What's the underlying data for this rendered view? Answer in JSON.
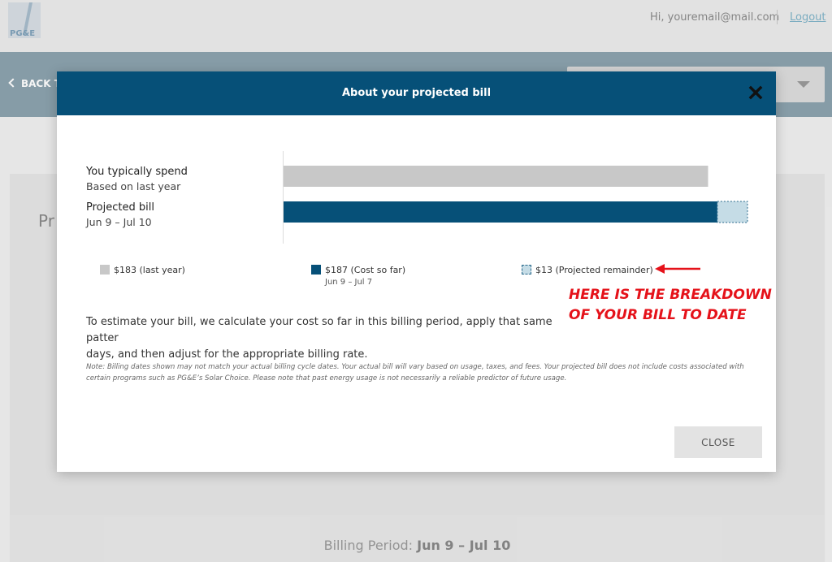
{
  "header": {
    "logo_text": "PG&E",
    "greeting": "Hi, youremail@mail.com",
    "logout_label": "Logout"
  },
  "nav": {
    "back_label": "BACK T"
  },
  "background": {
    "card_title_fragment": "Pr",
    "billing_period_label": "Billing Period:",
    "billing_period_value": "Jun 9 – Jul 10"
  },
  "modal": {
    "title": "About your projected bill",
    "rows": [
      {
        "label": "You typically spend",
        "sub": "Based on last year"
      },
      {
        "label": "Projected bill",
        "sub": "Jun 9 – Jul 10"
      }
    ],
    "legend": [
      {
        "text": "$183 (last year)",
        "color": "#c8c8c8"
      },
      {
        "text": "$187 (Cost so far)",
        "dates": "Jun 9 – Jul 7",
        "color": "#065078"
      },
      {
        "text": "$13 (Projected remainder)",
        "color": "#c5dce6"
      }
    ],
    "explanation": "To estimate your bill, we calculate your cost so far in this billing period, apply that same patter",
    "explanation_line2": "days, and then adjust for the appropriate billing rate.",
    "note": "Note: Billing dates shown may not match your actual billing cycle dates. Your actual bill will vary based on usage, taxes, and fees. Your projected bill does not include costs associated with certain programs such as PG&E’s Solar Choice. Please note that past energy usage is not necessarily a reliable predictor of future usage.",
    "close_label": "CLOSE"
  },
  "annotation": {
    "line1": "HERE IS THE BREAKDOWN",
    "line2": "OF YOUR BILL TO DATE",
    "color": "#e5121a"
  },
  "chart_data": {
    "type": "bar",
    "orientation": "horizontal",
    "categories": [
      "You typically spend",
      "Projected bill"
    ],
    "series": [
      {
        "name": "$183 (last year)",
        "values": [
          183,
          0
        ]
      },
      {
        "name": "$187 (Cost so far)",
        "values": [
          0,
          187
        ]
      },
      {
        "name": "$13 (Projected remainder)",
        "values": [
          0,
          13
        ]
      }
    ],
    "stacked": true
  },
  "colors": {
    "brand_blue": "#065078",
    "last_year_gray": "#c8c8c8",
    "remainder_light": "#c5dce6"
  }
}
